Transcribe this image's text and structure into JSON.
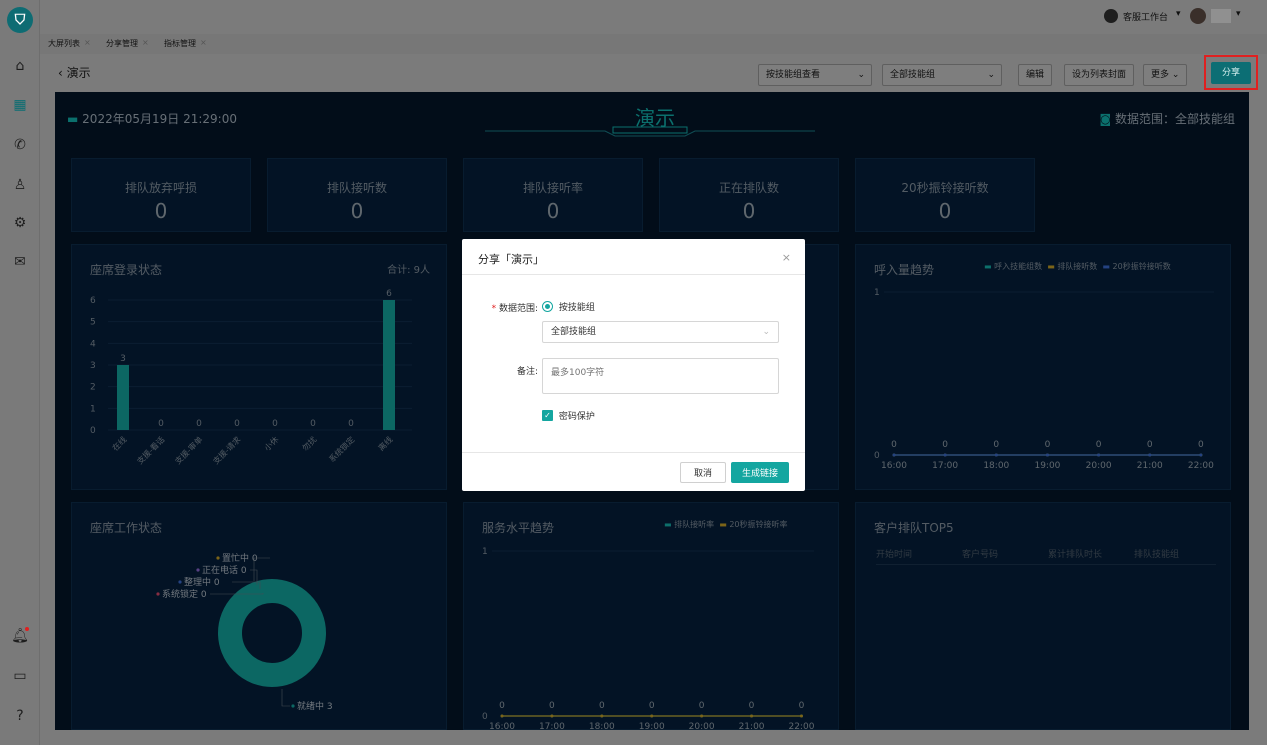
{
  "topbar": {
    "workbench_label": "客服工作台",
    "dropdown_arrow": "▾"
  },
  "tabs": [
    "大屏列表",
    "分享管理",
    "指标管理"
  ],
  "page": {
    "title": "演示"
  },
  "controls": {
    "view_select": "按技能组查看",
    "group_select": "全部技能组",
    "edit": "编辑",
    "set_cover": "设为列表封面",
    "more": "更多",
    "share": "分享"
  },
  "dashboard": {
    "datetime": "2022年05月19日 21:29:00",
    "title": "演示",
    "range_label": "数据范围：全部技能组",
    "kpis": [
      {
        "label": "排队放弃呼损",
        "value": "0"
      },
      {
        "label": "排队接听数",
        "value": "0"
      },
      {
        "label": "排队接听率",
        "value": "0"
      },
      {
        "label": "正在排队数",
        "value": "0"
      },
      {
        "label": "20秒振铃接听数",
        "value": "0"
      }
    ],
    "seat_login": {
      "title": "座席登录状态",
      "total": "合计: 9人"
    },
    "call_trend": {
      "title": "呼入量趋势",
      "legend": [
        "呼入技能组数",
        "排队接听数",
        "20秒振铃接听数"
      ]
    },
    "seat_work": {
      "title": "座席工作状态",
      "labels": [
        "置忙中 0",
        "正在电话 0",
        "整理中 0",
        "系统锁定 0",
        "就绪中 3"
      ]
    },
    "service_trend": {
      "title": "服务水平趋势",
      "legend": [
        "排队接听率",
        "20秒振铃接听率"
      ]
    },
    "top5": {
      "title": "客户排队TOP5",
      "columns": [
        "开始时间",
        "客户号码",
        "累计排队时长",
        "排队技能组"
      ]
    }
  },
  "chart_data": [
    {
      "type": "bar",
      "categories": [
        "在线",
        "支援-看话",
        "支援-审单",
        "支援-请求",
        "小休",
        "勿扰",
        "系统锁定",
        "离线"
      ],
      "values": [
        3,
        0,
        0,
        0,
        0,
        0,
        0,
        6
      ],
      "ylim": [
        0,
        6
      ],
      "yticks": [
        0,
        1,
        2,
        3,
        4,
        5,
        6
      ]
    },
    {
      "type": "line",
      "x": [
        "16:00",
        "17:00",
        "18:00",
        "19:00",
        "20:00",
        "21:00",
        "22:00"
      ],
      "series": [
        {
          "name": "呼入技能组数",
          "values": [
            0,
            0,
            0,
            0,
            0,
            0,
            0
          ],
          "color": "#15b3ad"
        },
        {
          "name": "排队接听数",
          "values": [
            0,
            0,
            0,
            0,
            0,
            0,
            0
          ],
          "color": "#c9a227"
        },
        {
          "name": "20秒振铃接听数",
          "values": [
            0,
            0,
            0,
            0,
            0,
            0,
            0
          ],
          "color": "#3a6bd1"
        }
      ],
      "ylim": [
        0,
        1
      ]
    },
    {
      "type": "pie",
      "categories": [
        "置忙中",
        "正在电话",
        "整理中",
        "系统锁定",
        "就绪中"
      ],
      "values": [
        0,
        0,
        0,
        0,
        3
      ]
    },
    {
      "type": "line",
      "x": [
        "16:00",
        "17:00",
        "18:00",
        "19:00",
        "20:00",
        "21:00",
        "22:00"
      ],
      "series": [
        {
          "name": "排队接听率",
          "values": [
            0,
            0,
            0,
            0,
            0,
            0,
            0
          ],
          "color": "#15b3ad"
        },
        {
          "name": "20秒振铃接听率",
          "values": [
            0,
            0,
            0,
            0,
            0,
            0,
            0
          ],
          "color": "#c9a227"
        }
      ],
      "ylim": [
        0,
        1
      ]
    }
  ],
  "modal": {
    "title": "分享「演示」",
    "close": "×",
    "range_label": "数据范围:",
    "radio_label": "按技能组",
    "select_value": "全部技能组",
    "note_label": "备注:",
    "note_placeholder": "最多100字符",
    "password_label": "密码保护",
    "cancel": "取消",
    "generate": "生成链接"
  },
  "colors": {
    "accent": "#14a6a0",
    "highlight_border": "#e02020",
    "dash_bg": "#041529"
  }
}
